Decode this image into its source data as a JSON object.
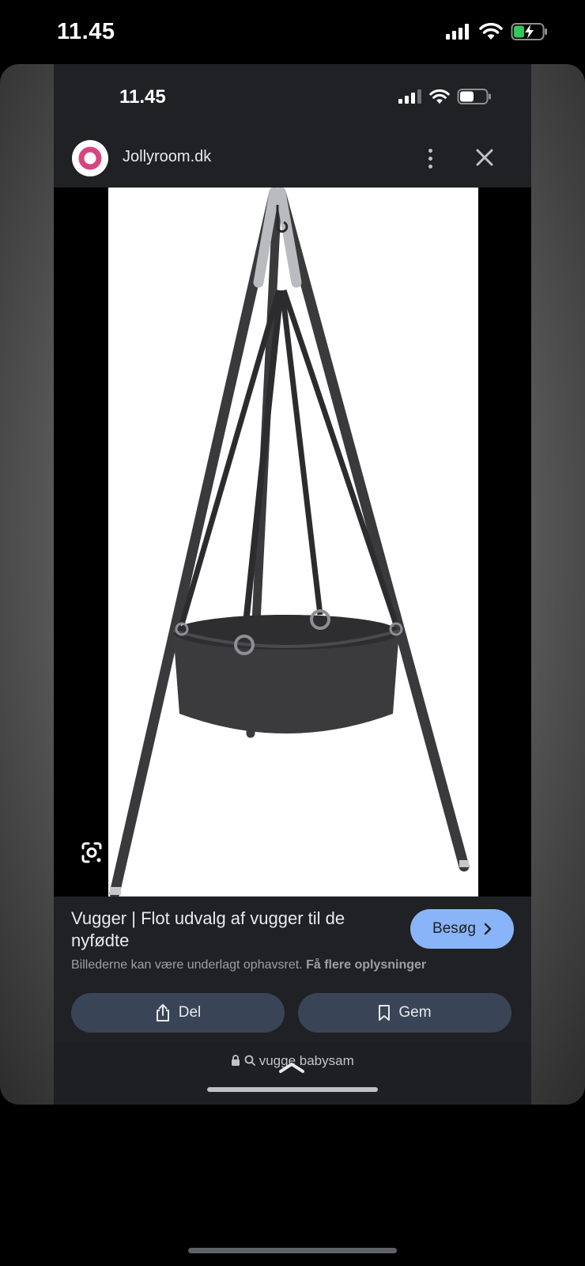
{
  "outer_status": {
    "time": "11.45"
  },
  "inner_status": {
    "time": "11.45"
  },
  "site": {
    "name": "Jollyroom.dk"
  },
  "result": {
    "title": "Vugger | Flot udvalg af vugger til de nyfødte",
    "visit_label": "Besøg",
    "copyright_text": "Billederne kan være underlagt ophavsret.",
    "copyright_link": "Få flere oplysninger",
    "share_label": "Del",
    "save_label": "Gem"
  },
  "url_bar": {
    "query": "vugge babysam"
  },
  "colors": {
    "accent": "#8ab4f8",
    "button_bg": "#394457",
    "logo_ring": "#d6457f"
  },
  "icons": [
    "signal-icon",
    "wifi-icon",
    "battery-charging-icon",
    "battery-icon",
    "more-vert-icon",
    "close-icon",
    "lens-icon",
    "chevron-right-icon",
    "share-icon",
    "bookmark-icon",
    "lock-icon",
    "search-icon",
    "chevron-up-icon"
  ]
}
